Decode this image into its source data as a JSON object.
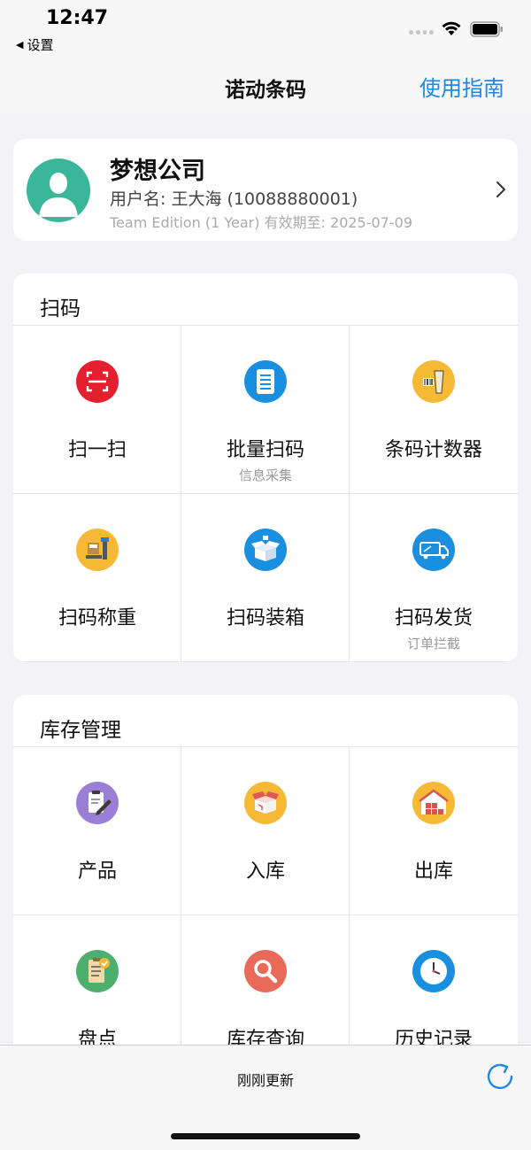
{
  "status_bar": {
    "time": "12:47",
    "back_label": "设置"
  },
  "nav": {
    "title": "诺动条码",
    "guide": "使用指南"
  },
  "account": {
    "company": "梦想公司",
    "username": "用户名: 王大海 (10088880001)",
    "license": "Team Edition (1 Year)  有效期至: 2025-07-09"
  },
  "scan_section": {
    "title": "扫码",
    "items": [
      {
        "label": "扫一扫",
        "sub": ""
      },
      {
        "label": "批量扫码",
        "sub": "信息采集"
      },
      {
        "label": "条码计数器",
        "sub": ""
      },
      {
        "label": "扫码称重",
        "sub": ""
      },
      {
        "label": "扫码装箱",
        "sub": ""
      },
      {
        "label": "扫码发货",
        "sub": "订单拦截"
      }
    ]
  },
  "stock_section": {
    "title": "库存管理",
    "items": [
      {
        "label": "产品"
      },
      {
        "label": "入库"
      },
      {
        "label": "出库"
      },
      {
        "label": "盘点"
      },
      {
        "label": "库存查询"
      },
      {
        "label": "历史记录"
      }
    ]
  },
  "bottom": {
    "update_text": "刚刚更新"
  },
  "colors": {
    "accent": "#1e88e5",
    "avatar": "#3ab79a",
    "scan_red": "#e5202e",
    "blue": "#1a8fe0",
    "yellow": "#f5b935",
    "purple": "#9b7fd6",
    "salmon": "#ea6a5a"
  },
  "icons": {
    "scan": "scan-frame-icon",
    "batch": "document-list-icon",
    "counter": "barcode-scanner-icon",
    "weigh": "scale-icon",
    "pack": "open-box-icon",
    "ship": "truck-icon",
    "product": "edit-document-icon",
    "inbound": "box-icon",
    "outbound": "warehouse-icon",
    "inventory": "clipboard-check-icon",
    "query": "magnifier-icon",
    "history": "clock-icon"
  }
}
